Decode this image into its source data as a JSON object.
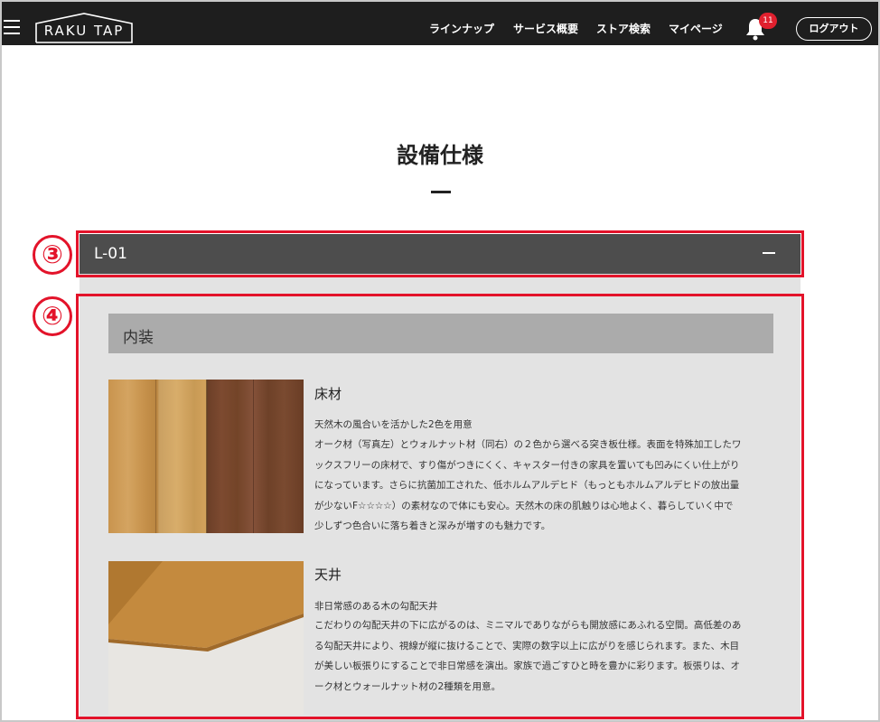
{
  "header": {
    "logo_text": "RAKU TAP",
    "nav": [
      "ラインナップ",
      "サービス概要",
      "ストア検索",
      "マイページ"
    ],
    "notification_count": "11",
    "logout_label": "ログアウト"
  },
  "page": {
    "title": "設備仕様"
  },
  "accordion": {
    "label": "L-01",
    "section_label": "内装",
    "items": [
      {
        "title": "床材",
        "subtitle": "天然木の風合いを活かした2色を用意",
        "lines": [
          "オーク材（写真左）とウォルナット材（同右）の２色から選べる突き板仕様。表面を特殊加工したワ",
          "ックスフリーの床材で、すり傷がつきにくく、キャスター付きの家具を置いても凹みにくい仕上がり",
          "になっています。さらに抗菌加工された、低ホルムアルデヒド（もっともホルムアルデヒドの放出量",
          "が少ないF☆☆☆☆）の素材なので体にも安心。天然木の床の肌触りは心地よく、暮らしていく中で",
          "少しずつ色合いに落ち着きと深みが増すのも魅力です。"
        ]
      },
      {
        "title": "天井",
        "subtitle": "非日常感のある木の勾配天井",
        "lines": [
          "こだわりの勾配天井の下に広がるのは、ミニマルでありながらも開放感にあふれる空間。高低差のあ",
          "る勾配天井により、視線が縦に抜けることで、実際の数字以上に広がりを感じられます。また、木目",
          "が美しい板張りにすることで非日常感を演出。家族で過ごすひと時を豊かに彩ります。板張りは、オ",
          "ーク材とウォールナット材の2種類を用意。"
        ]
      }
    ]
  },
  "annotations": [
    "③",
    "④"
  ],
  "colors": {
    "annotation_red": "#e3132a",
    "header_bg": "#1e1e1e",
    "accordion_header_bg": "#4d4d4d"
  }
}
